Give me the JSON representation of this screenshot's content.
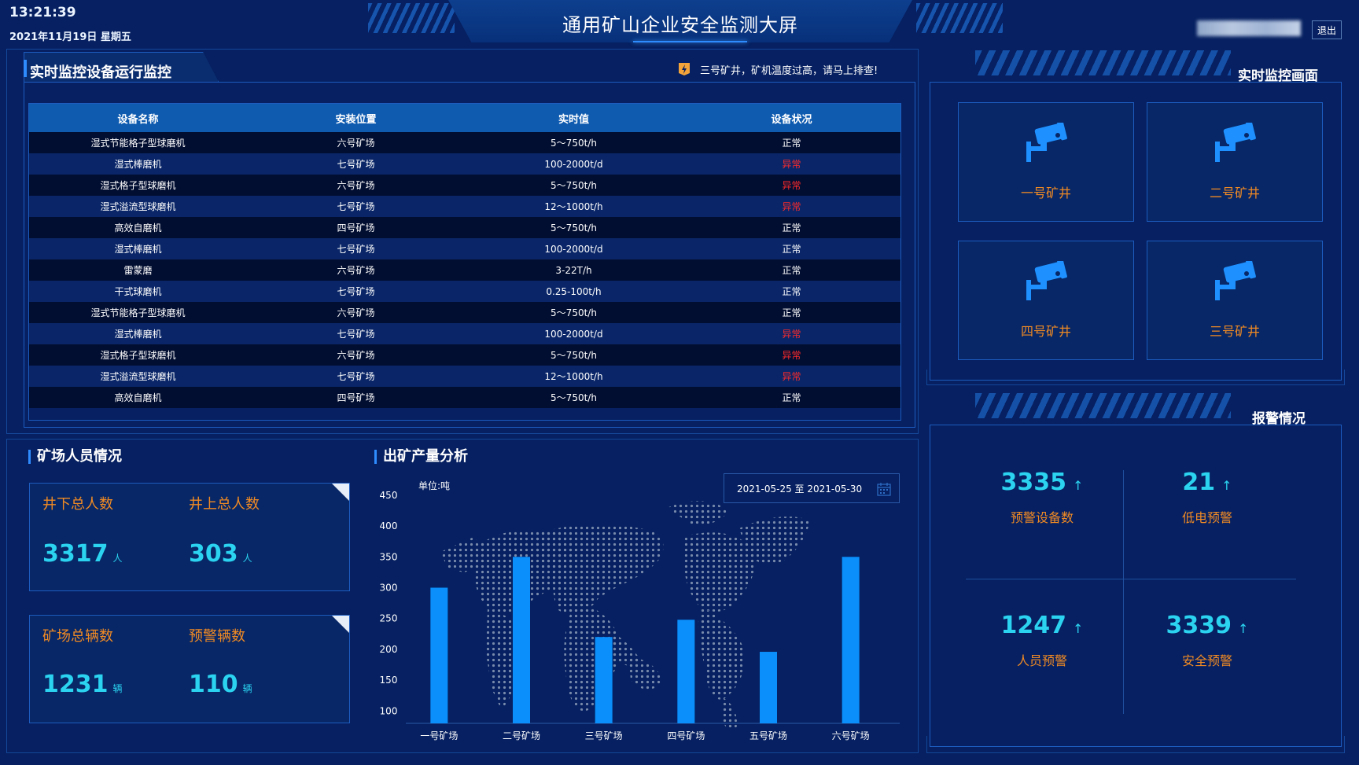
{
  "header": {
    "time": "13:21:39",
    "date": "2021年11月19日 星期五",
    "title": "通用矿山企业安全监测大屏",
    "logout_label": "退出"
  },
  "equipment_panel": {
    "title": "实时监控设备运行监控",
    "alert_text": "三号矿井，矿机温度过高，请马上排查!",
    "columns": [
      "设备名称",
      "安装位置",
      "实时值",
      "设备状况"
    ],
    "rows": [
      {
        "name": "湿式节能格子型球磨机",
        "location": "六号矿场",
        "value": "5～750t/h",
        "status": "正常",
        "abnormal": false
      },
      {
        "name": "湿式棒磨机",
        "location": "七号矿场",
        "value": "100-2000t/d",
        "status": "异常",
        "abnormal": true
      },
      {
        "name": "湿式格子型球磨机",
        "location": "六号矿场",
        "value": "5～750t/h",
        "status": "异常",
        "abnormal": true
      },
      {
        "name": "湿式溢流型球磨机",
        "location": "七号矿场",
        "value": "12～1000t/h",
        "status": "异常",
        "abnormal": true
      },
      {
        "name": "高效自磨机",
        "location": "四号矿场",
        "value": "5～750t/h",
        "status": "正常",
        "abnormal": false
      },
      {
        "name": "湿式棒磨机",
        "location": "七号矿场",
        "value": "100-2000t/d",
        "status": "正常",
        "abnormal": false
      },
      {
        "name": "雷蒙磨",
        "location": "六号矿场",
        "value": "3-22T/h",
        "status": "正常",
        "abnormal": false
      },
      {
        "name": "干式球磨机",
        "location": "七号矿场",
        "value": "0.25-100t/h",
        "status": "正常",
        "abnormal": false
      },
      {
        "name": "湿式节能格子型球磨机",
        "location": "六号矿场",
        "value": "5～750t/h",
        "status": "正常",
        "abnormal": false
      },
      {
        "name": "湿式棒磨机",
        "location": "七号矿场",
        "value": "100-2000t/d",
        "status": "异常",
        "abnormal": true
      },
      {
        "name": "湿式格子型球磨机",
        "location": "六号矿场",
        "value": "5～750t/h",
        "status": "异常",
        "abnormal": true
      },
      {
        "name": "湿式溢流型球磨机",
        "location": "七号矿场",
        "value": "12～1000t/h",
        "status": "异常",
        "abnormal": true
      },
      {
        "name": "高效自磨机",
        "location": "四号矿场",
        "value": "5～750t/h",
        "status": "正常",
        "abnormal": false
      }
    ]
  },
  "personnel": {
    "title": "矿场人员情况",
    "underground_label": "井下总人数",
    "underground_value": "3317",
    "aboveground_label": "井上总人数",
    "aboveground_value": "303",
    "person_unit": "人",
    "vehicles_label": "矿场总辆数",
    "vehicles_value": "1231",
    "warn_vehicles_label": "预警辆数",
    "warn_vehicles_value": "110",
    "vehicle_unit": "辆"
  },
  "output": {
    "title": "出矿产量分析",
    "unit_label": "单位:吨",
    "date_range": "2021-05-25 至 2021-05-30"
  },
  "chart_data": {
    "type": "bar",
    "categories": [
      "一号矿场",
      "二号矿场",
      "三号矿场",
      "四号矿场",
      "五号矿场",
      "六号矿场"
    ],
    "values": [
      300,
      350,
      220,
      248,
      196,
      350
    ],
    "yticks": [
      100,
      150,
      200,
      250,
      300,
      350,
      400,
      450
    ],
    "ylim": [
      80,
      460
    ],
    "bar_color": "#0a8ffb",
    "ylabel": "单位:吨"
  },
  "monitor": {
    "title": "实时监控画面",
    "cameras": [
      {
        "label": "一号矿井"
      },
      {
        "label": "二号矿井"
      },
      {
        "label": "四号矿井"
      },
      {
        "label": "三号矿井"
      }
    ]
  },
  "alarms": {
    "title": "报警情况",
    "items": [
      {
        "value": "3335",
        "label": "预警设备数",
        "arrow": "↑"
      },
      {
        "value": "21",
        "label": "低电预警",
        "arrow": "↑"
      },
      {
        "value": "1247",
        "label": "人员预警",
        "arrow": "↑"
      },
      {
        "value": "3339",
        "label": "安全预警",
        "arrow": "↑"
      }
    ]
  },
  "colors": {
    "background": "#062061",
    "accent_cyan": "#2bd3f0",
    "label_orange": "#f08a24",
    "abnormal_red": "#ff2a2a",
    "bar_blue": "#0a8ffb"
  }
}
